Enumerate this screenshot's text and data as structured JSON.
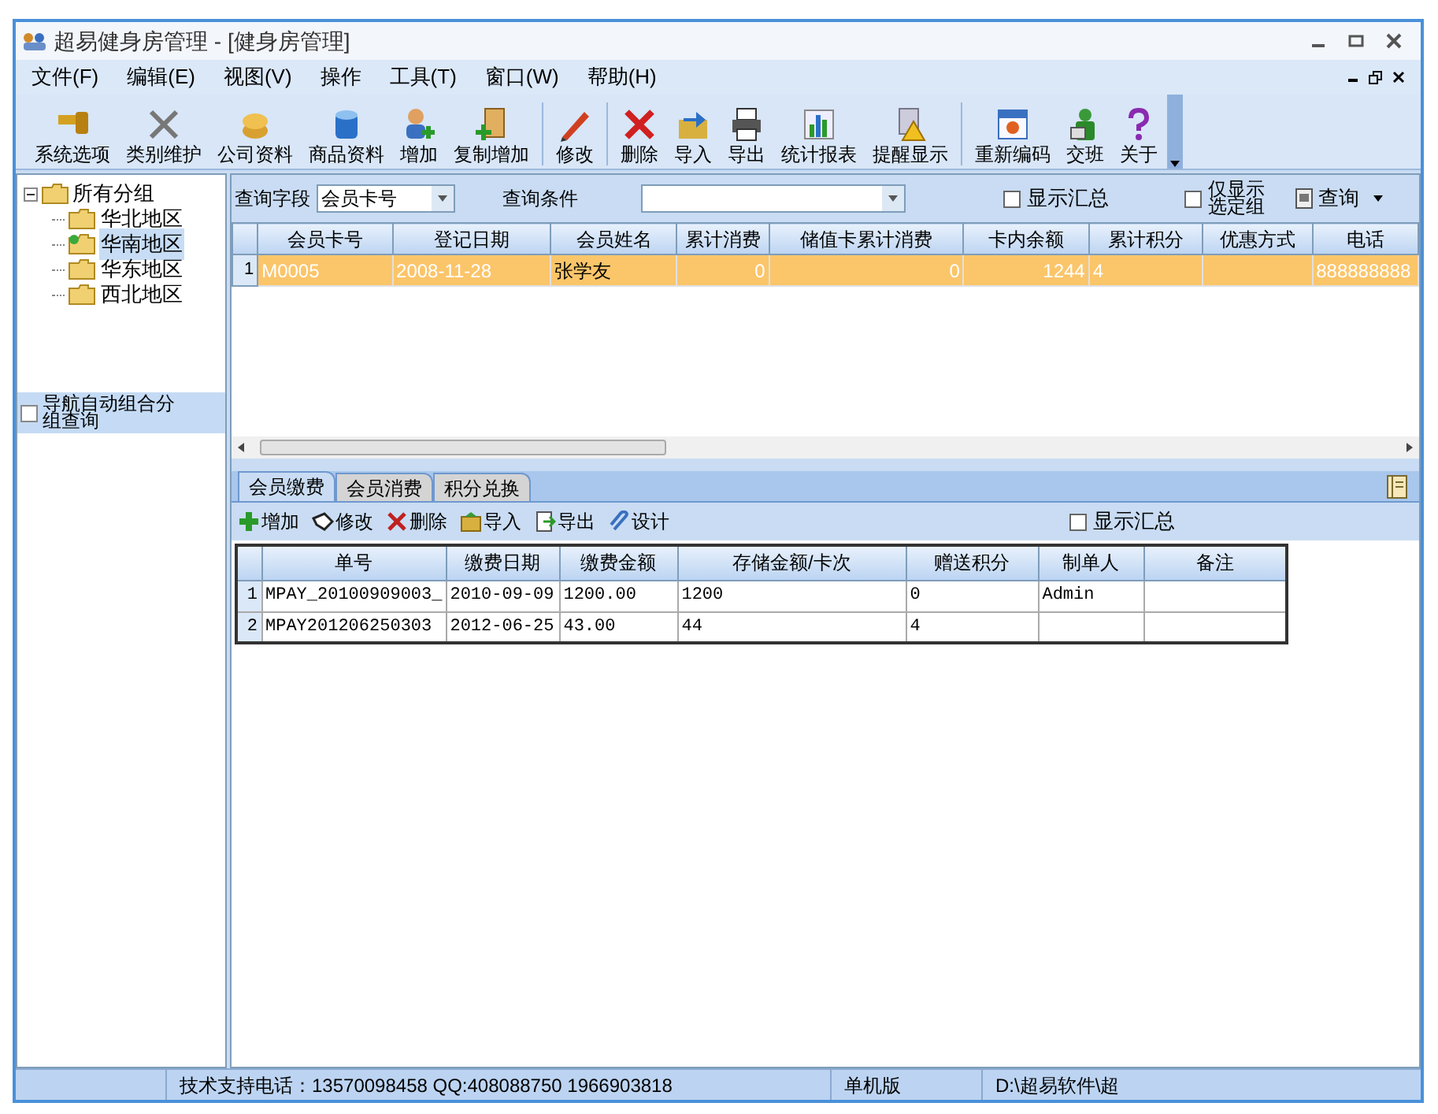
{
  "window": {
    "title": "超易健身房管理 - [健身房管理]"
  },
  "menu": [
    "文件(F)",
    "编辑(E)",
    "视图(V)",
    "操作",
    "工具(T)",
    "窗口(W)",
    "帮助(H)"
  ],
  "toolbar": [
    "系统选项",
    "类别维护",
    "公司资料",
    "商品资料",
    "增加",
    "复制增加",
    "修改",
    "删除",
    "导入",
    "导出",
    "统计报表",
    "提醒显示",
    "重新编码",
    "交班",
    "关于"
  ],
  "tree": {
    "label": "所有分组",
    "expanded": true,
    "children": [
      {
        "label": "华北地区",
        "selected": false
      },
      {
        "label": "华南地区",
        "selected": true
      },
      {
        "label": "华东地区",
        "selected": false
      },
      {
        "label": "西北地区",
        "selected": false
      }
    ]
  },
  "nav_option": {
    "label": "导航自动组合分组查询",
    "checked": false
  },
  "query": {
    "field_label": "查询字段",
    "field_value": "会员卡号",
    "condition_label": "查询条件",
    "show_total": {
      "label": "显示汇总",
      "checked": false
    },
    "only_selected": {
      "label": "仅显示选定组",
      "checked": false
    },
    "search_button": "查询"
  },
  "members": {
    "columns": [
      "会员卡号",
      "登记日期",
      "会员姓名",
      "累计消费",
      "储值卡累计消费",
      "卡内余额",
      "累计积分",
      "优惠方式",
      "电话"
    ],
    "rows": [
      {
        "number": "1",
        "selected": true,
        "cells": [
          "M0005",
          "2008-11-28",
          "张学友",
          "0",
          "0",
          "1244",
          "4",
          "",
          "888888888"
        ]
      }
    ]
  },
  "tabs": [
    {
      "label": "会员缴费",
      "selected": true
    },
    {
      "label": "会员消费",
      "selected": false
    },
    {
      "label": "积分兑换",
      "selected": false
    }
  ],
  "sub_toolbar": [
    "增加",
    "修改",
    "删除",
    "导入",
    "导出",
    "设计"
  ],
  "sub_show_total": {
    "label": "显示汇总",
    "checked": false
  },
  "payments": {
    "columns": [
      "单号",
      "缴费日期",
      "缴费金额",
      "存储金额/卡次",
      "赠送积分",
      "制单人",
      "备注"
    ],
    "rows": [
      {
        "number": "1",
        "cells": [
          "MPAY_20100909003_",
          "2010-09-09",
          "1200.00",
          "1200",
          "0",
          "Admin",
          ""
        ]
      },
      {
        "number": "2",
        "cells": [
          "MPAY201206250303",
          "2012-06-25",
          "43.00",
          "44",
          "4",
          "",
          ""
        ]
      }
    ]
  },
  "status_bar": [
    "技术支持电话：13570098458 QQ:408088750 1966903818",
    "单机版",
    "D:\\超易软件\\超"
  ]
}
